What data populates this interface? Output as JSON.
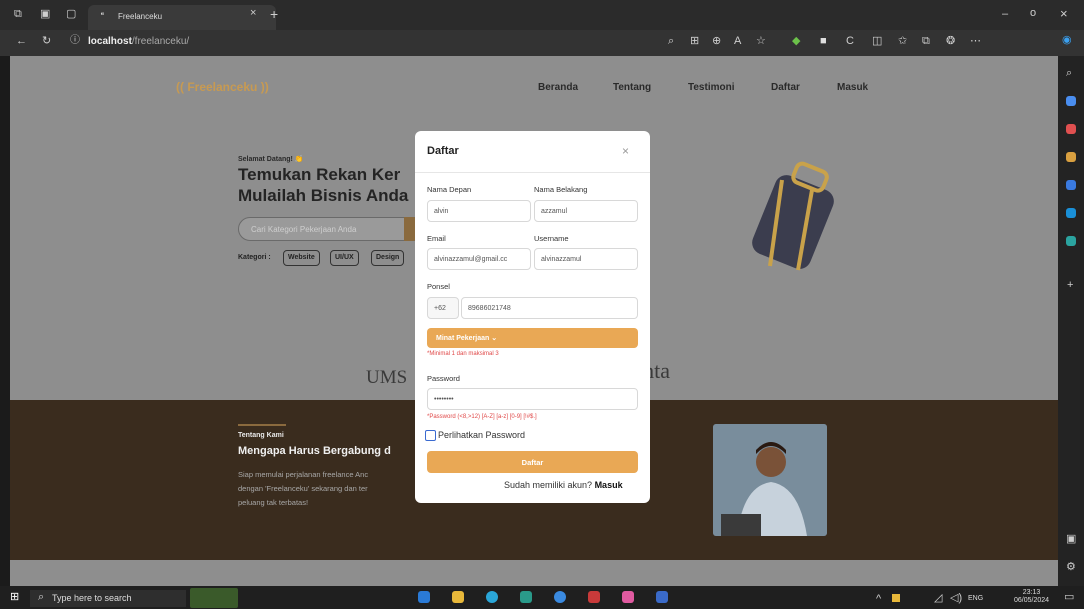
{
  "browser": {
    "tab_title": "Freelanceku",
    "url_host": "localhost",
    "url_path": "/freelanceku/"
  },
  "site": {
    "logo": "(( Freelanceku ))",
    "nav": [
      "Beranda",
      "Tentang",
      "Testimoni",
      "Daftar",
      "Masuk"
    ],
    "welcome": "Selamat Datang! 👏",
    "hero_line1": "Temukan Rekan Ker",
    "hero_line2": "Mulailah Bisnis Anda",
    "search_placeholder": "Cari Kategori Pekerjaan Anda",
    "kategori_label": "Kategori :",
    "chips": [
      "Website",
      "UI/UX",
      "Design"
    ],
    "partner_left": "UMS",
    "partner_right": "inta",
    "tentang_label": "Tentang Kami",
    "tentang_title": "Mengapa Harus Bergabung d",
    "tentang_body": [
      "Siap memulai perjalanan freelance Anc",
      "dengan 'Freelanceku' sekarang dan ter",
      "peluang tak terbatas!"
    ]
  },
  "modal": {
    "title": "Daftar",
    "close": "×",
    "first_name_label": "Nama Depan",
    "first_name_value": "alvin",
    "last_name_label": "Nama Belakang",
    "last_name_value": "azzamul",
    "email_label": "Email",
    "email_value": "alvinazzamul@gmail.cc",
    "username_label": "Username",
    "username_value": "alvinazzamul",
    "phone_label": "Ponsel",
    "phone_prefix": "+62",
    "phone_value": "89686021748",
    "minat_label": "Minat Pekerjaan ⌄",
    "minat_error": "*Minimal 1 dan maksimal 3",
    "password_label": "Password",
    "password_value": "••••••••",
    "password_error": "*Password (<8,>12) [A-Z] [a-z] [0-9] [!#$.]",
    "show_password": "Perlihatkan Password",
    "submit": "Daftar",
    "login_question": "Sudah memiliki akun?",
    "login_link": "Masuk"
  },
  "taskbar": {
    "search": "Type here to search",
    "time": "23:13",
    "date": "06/05/2024",
    "lang": "ENG"
  }
}
